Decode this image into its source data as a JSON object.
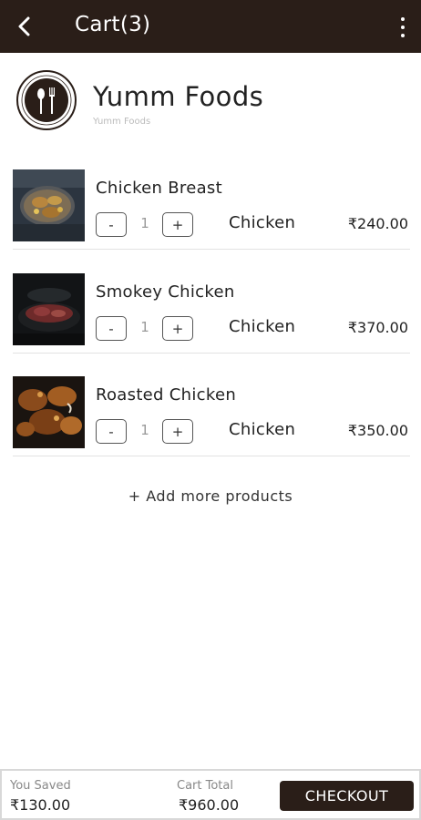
{
  "appbar": {
    "title": "Cart(3)"
  },
  "store": {
    "name": "Yumm Foods",
    "subtitle": "Yumm Foods",
    "logo_text": "YUMM FOODS"
  },
  "items": [
    {
      "name": "Chicken Breast",
      "qty": "1",
      "minus": "-",
      "plus": "+",
      "category": "Chicken",
      "price": "₹240.00"
    },
    {
      "name": "Smokey Chicken",
      "qty": "1",
      "minus": "-",
      "plus": "+",
      "category": "Chicken",
      "price": "₹370.00"
    },
    {
      "name": "Roasted Chicken",
      "qty": "1",
      "minus": "-",
      "plus": "+",
      "category": "Chicken",
      "price": "₹350.00"
    }
  ],
  "add_more": "+ Add more products",
  "footer": {
    "saved_label": "You Saved",
    "saved_value": "₹130.00",
    "total_label": "Cart Total",
    "total_value": "₹960.00",
    "checkout_label": "CHECKOUT"
  },
  "colors": {
    "brand": "#2a1e18",
    "divider": "#e2e2e2",
    "muted": "#888888"
  }
}
